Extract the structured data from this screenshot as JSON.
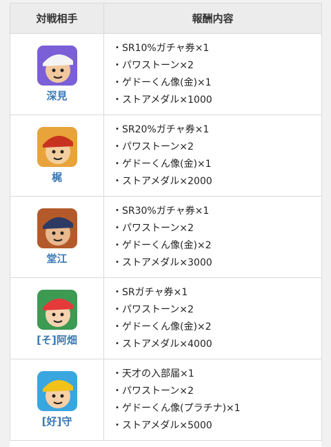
{
  "table": {
    "headers": {
      "character": "対戦相手",
      "rewards": "報酬内容"
    },
    "rows": [
      {
        "name": "深見",
        "avatar_colors": {
          "bg": "#7a5fd6",
          "accent": "#f4f4f4",
          "skin": "#f1c79e"
        },
        "rewards": [
          "SR10%ガチャ券×1",
          "パワストーン×2",
          "ゲドーくん像(金)×1",
          "ストアメダル×1000"
        ]
      },
      {
        "name": "梶",
        "avatar_colors": {
          "bg": "#e8a33a",
          "accent": "#c8331f",
          "skin": "#f3cf9f"
        },
        "rewards": [
          "SR20%ガチャ券×1",
          "パワストーン×2",
          "ゲドーくん像(金)×1",
          "ストアメダル×2000"
        ]
      },
      {
        "name": "堂江",
        "avatar_colors": {
          "bg": "#b45a2a",
          "accent": "#2d3a63",
          "skin": "#e8b98e"
        },
        "rewards": [
          "SR30%ガチャ券×1",
          "パワストーン×2",
          "ゲドーくん像(金)×2",
          "ストアメダル×3000"
        ]
      },
      {
        "name": "[そ]阿畑",
        "avatar_colors": {
          "bg": "#3c9a52",
          "accent": "#e43a3a",
          "skin": "#f6d3b0"
        },
        "rewards": [
          "SRガチャ券×1",
          "パワストーン×2",
          "ゲドーくん像(金)×2",
          "ストアメダル×4000"
        ]
      },
      {
        "name": "[好]守",
        "avatar_colors": {
          "bg": "#3aa6e0",
          "accent": "#f2c21a",
          "skin": "#f6d1a8"
        },
        "rewards": [
          "天才の入部届×1",
          "パワストーン×2",
          "ゲドーくん像(プラチナ)×1",
          "ストアメダル×5000"
        ]
      }
    ]
  }
}
